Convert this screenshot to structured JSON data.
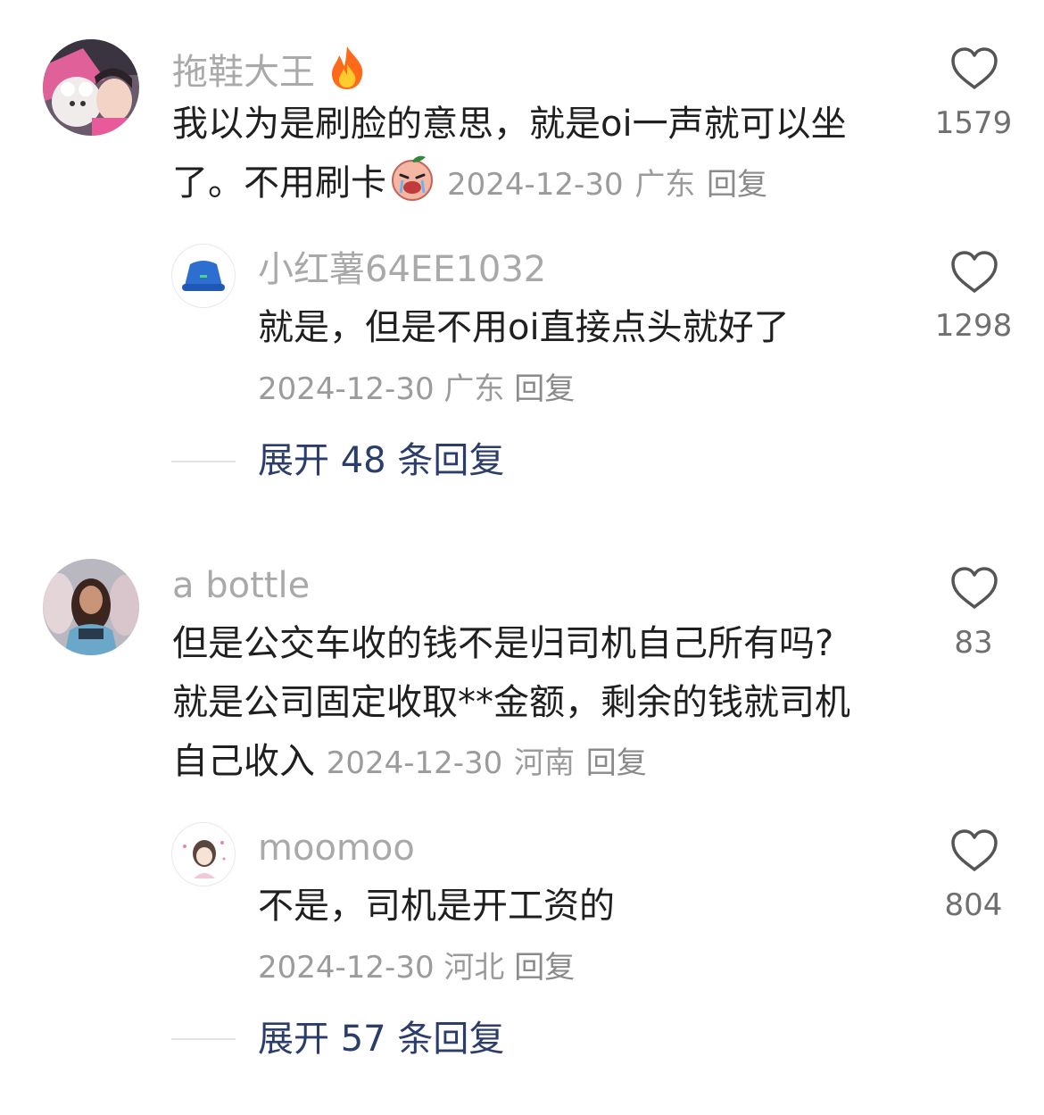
{
  "comments": [
    {
      "username": "拖鞋大王",
      "text_line1": "我以为是刷脸的意思，就是oi一声就可以坐",
      "text_line2": "了。不用刷卡",
      "date": "2024-12-30",
      "location": "广东",
      "reply_label": "回复",
      "likes": "1579",
      "icons": {
        "badge": "fire-emoji-icon",
        "inline": "crying-peach-emoji-icon",
        "like": "heart-outline-icon"
      },
      "replies": [
        {
          "username": "小红薯64EE1032",
          "text": "就是，但是不用oi直接点头就好了",
          "date": "2024-12-30",
          "location": "广东",
          "reply_label": "回复",
          "likes": "1298"
        }
      ],
      "expand_label": "展开 48 条回复"
    },
    {
      "username": "a bottle",
      "text_line1": "但是公交车收的钱不是归司机自己所有吗?",
      "text_line2": "就是公司固定收取**金额，剩余的钱就司机",
      "text_line3": "自己收入",
      "date": "2024-12-30",
      "location": "河南",
      "reply_label": "回复",
      "likes": "83",
      "replies": [
        {
          "username": "moomoo",
          "text": "不是，司机是开工资的",
          "date": "2024-12-30",
          "location": "河北",
          "reply_label": "回复",
          "likes": "804"
        }
      ],
      "expand_label": "展开 57 条回复"
    }
  ],
  "colors": {
    "expand_link": "#2b3e6b",
    "meta": "#9b9b9b",
    "username": "#a9a9a9"
  }
}
